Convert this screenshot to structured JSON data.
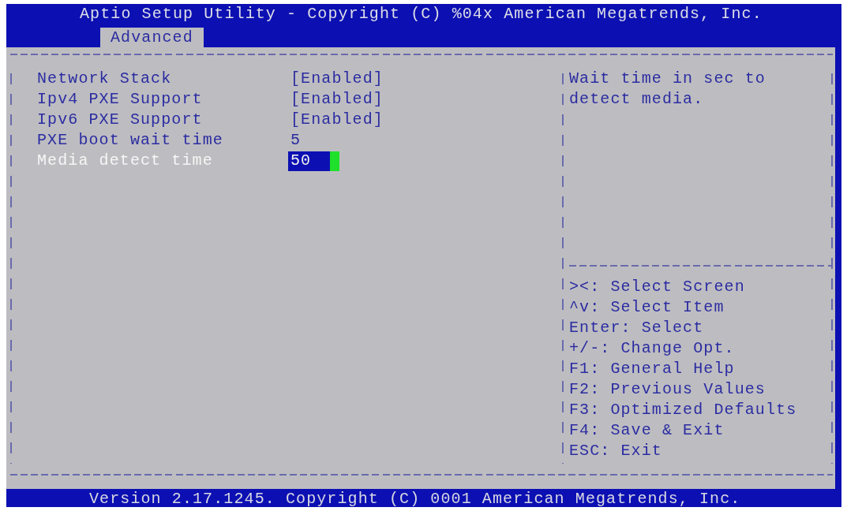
{
  "title": "Aptio Setup Utility - Copyright (C) %04x American Megatrends, Inc.",
  "tabs": [
    {
      "label": "Advanced",
      "selected": true
    }
  ],
  "settings": [
    {
      "label": "Network Stack",
      "value": "[Enabled]",
      "selected": false
    },
    {
      "label": "Ipv4 PXE Support",
      "value": "[Enabled]",
      "selected": false
    },
    {
      "label": "Ipv6 PXE Support",
      "value": "[Enabled]",
      "selected": false
    },
    {
      "label": "PXE boot wait time",
      "value": "5",
      "selected": false
    },
    {
      "label": "Media detect time",
      "value": "50",
      "selected": true
    }
  ],
  "help": {
    "description": "Wait time in sec to detect media.",
    "keys": [
      "><: Select Screen",
      "^v: Select Item",
      "Enter: Select",
      "+/-: Change Opt.",
      "F1: General Help",
      "F2: Previous Values",
      "F3: Optimized Defaults",
      "F4: Save & Exit",
      "ESC: Exit"
    ]
  },
  "status_bar": "Version 2.17.1245. Copyright (C) 0001 American Megatrends, Inc."
}
